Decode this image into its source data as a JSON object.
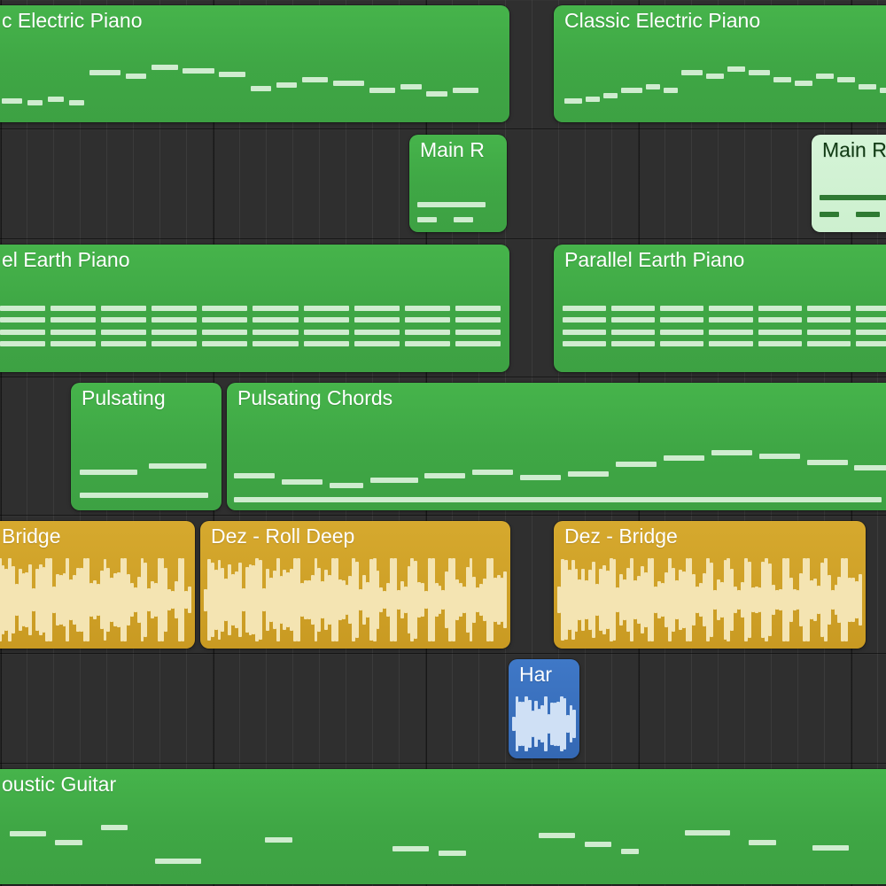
{
  "colors": {
    "midi_region": "#3fa745",
    "midi_note": "#cfeccf",
    "audio_region": "#c99a22",
    "audio_wave": "#f4e4b2",
    "audio_blue_region": "#3468b3",
    "audio_blue_wave": "#cfe0f5",
    "selected_region": "#cdf0cf",
    "background": "#2f2f2f"
  },
  "track_row_tops": [
    0,
    146,
    270,
    426,
    582,
    738,
    862
  ],
  "track_row_heights": [
    146,
    124,
    156,
    156,
    156,
    124,
    140
  ],
  "regions": {
    "ep1": {
      "label": "c Electric Piano"
    },
    "ep2": {
      "label": "Classic Electric Piano"
    },
    "mainr1": {
      "label": "Main R"
    },
    "mainr2": {
      "label": "Main R"
    },
    "earth1": {
      "label": "el Earth Piano"
    },
    "earth2": {
      "label": "Parallel Earth Piano"
    },
    "puls1": {
      "label": "Pulsating"
    },
    "puls2": {
      "label": "Pulsating Chords"
    },
    "bridge1": {
      "label": "Bridge"
    },
    "rolldeep": {
      "label": "Dez - Roll Deep"
    },
    "bridge2": {
      "label": "Dez - Bridge"
    },
    "har": {
      "label": "Har"
    },
    "acoustic": {
      "label": "oustic Guitar"
    }
  }
}
